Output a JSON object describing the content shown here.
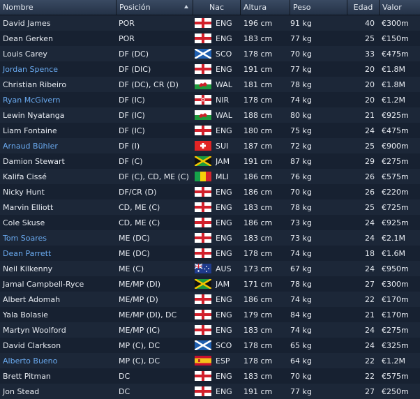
{
  "columns": {
    "name": "Nombre",
    "position": "Posición",
    "nationality": "Nac",
    "height": "Altura",
    "weight": "Peso",
    "age": "Edad",
    "value": "Valor"
  },
  "players": [
    {
      "name": "David James",
      "linked": false,
      "position": "POR",
      "flag": "eng",
      "nat": "ENG",
      "height": "196 cm",
      "weight": "91 kg",
      "age": "40",
      "value": "€300m"
    },
    {
      "name": "Dean Gerken",
      "linked": false,
      "position": "POR",
      "flag": "eng",
      "nat": "ENG",
      "height": "183 cm",
      "weight": "77 kg",
      "age": "25",
      "value": "€150m"
    },
    {
      "name": "Louis Carey",
      "linked": false,
      "position": "DF (DC)",
      "flag": "sco",
      "nat": "SCO",
      "height": "178 cm",
      "weight": "70 kg",
      "age": "33",
      "value": "€475m"
    },
    {
      "name": "Jordan Spence",
      "linked": true,
      "position": "DF (DIC)",
      "flag": "eng",
      "nat": "ENG",
      "height": "191 cm",
      "weight": "77 kg",
      "age": "20",
      "value": "€1.8M"
    },
    {
      "name": "Christian Ribeiro",
      "linked": false,
      "position": "DF (DC), CR (D)",
      "flag": "wal",
      "nat": "WAL",
      "height": "181 cm",
      "weight": "78 kg",
      "age": "20",
      "value": "€1.8M"
    },
    {
      "name": "Ryan McGivern",
      "linked": true,
      "position": "DF (IC)",
      "flag": "nir",
      "nat": "NIR",
      "height": "178 cm",
      "weight": "74 kg",
      "age": "20",
      "value": "€1.2M"
    },
    {
      "name": "Lewin Nyatanga",
      "linked": false,
      "position": "DF (IC)",
      "flag": "wal",
      "nat": "WAL",
      "height": "188 cm",
      "weight": "80 kg",
      "age": "21",
      "value": "€925m"
    },
    {
      "name": "Liam Fontaine",
      "linked": false,
      "position": "DF (IC)",
      "flag": "eng",
      "nat": "ENG",
      "height": "180 cm",
      "weight": "75 kg",
      "age": "24",
      "value": "€475m"
    },
    {
      "name": "Arnaud Bühler",
      "linked": true,
      "position": "DF (I)",
      "flag": "sui",
      "nat": "SUI",
      "height": "187 cm",
      "weight": "72 kg",
      "age": "25",
      "value": "€900m"
    },
    {
      "name": "Damion Stewart",
      "linked": false,
      "position": "DF (C)",
      "flag": "jam",
      "nat": "JAM",
      "height": "191 cm",
      "weight": "87 kg",
      "age": "29",
      "value": "€275m"
    },
    {
      "name": "Kalifa Cissé",
      "linked": false,
      "position": "DF (C), CD, ME (C)",
      "flag": "mli",
      "nat": "MLI",
      "height": "186 cm",
      "weight": "76 kg",
      "age": "26",
      "value": "€575m"
    },
    {
      "name": "Nicky Hunt",
      "linked": false,
      "position": "DF/CR (D)",
      "flag": "eng",
      "nat": "ENG",
      "height": "186 cm",
      "weight": "70 kg",
      "age": "26",
      "value": "€220m"
    },
    {
      "name": "Marvin Elliott",
      "linked": false,
      "position": "CD, ME (C)",
      "flag": "eng",
      "nat": "ENG",
      "height": "183 cm",
      "weight": "78 kg",
      "age": "25",
      "value": "€725m"
    },
    {
      "name": "Cole Skuse",
      "linked": false,
      "position": "CD, ME (C)",
      "flag": "eng",
      "nat": "ENG",
      "height": "186 cm",
      "weight": "73 kg",
      "age": "24",
      "value": "€925m"
    },
    {
      "name": "Tom Soares",
      "linked": true,
      "position": "ME (DC)",
      "flag": "eng",
      "nat": "ENG",
      "height": "183 cm",
      "weight": "73 kg",
      "age": "24",
      "value": "€2.1M"
    },
    {
      "name": "Dean Parrett",
      "linked": true,
      "position": "ME (DC)",
      "flag": "eng",
      "nat": "ENG",
      "height": "178 cm",
      "weight": "74 kg",
      "age": "18",
      "value": "€1.6M"
    },
    {
      "name": "Neil Kilkenny",
      "linked": false,
      "position": "ME (C)",
      "flag": "aus",
      "nat": "AUS",
      "height": "173 cm",
      "weight": "67 kg",
      "age": "24",
      "value": "€950m"
    },
    {
      "name": "Jamal Campbell-Ryce",
      "linked": false,
      "position": "ME/MP (DI)",
      "flag": "jam",
      "nat": "JAM",
      "height": "171 cm",
      "weight": "78 kg",
      "age": "27",
      "value": "€300m"
    },
    {
      "name": "Albert Adomah",
      "linked": false,
      "position": "ME/MP (D)",
      "flag": "eng",
      "nat": "ENG",
      "height": "186 cm",
      "weight": "74 kg",
      "age": "22",
      "value": "€170m"
    },
    {
      "name": "Yala Bolasie",
      "linked": false,
      "position": "ME/MP (DI), DC",
      "flag": "eng",
      "nat": "ENG",
      "height": "179 cm",
      "weight": "84 kg",
      "age": "21",
      "value": "€170m"
    },
    {
      "name": "Martyn Woolford",
      "linked": false,
      "position": "ME/MP (IC)",
      "flag": "eng",
      "nat": "ENG",
      "height": "183 cm",
      "weight": "74 kg",
      "age": "24",
      "value": "€275m"
    },
    {
      "name": "David Clarkson",
      "linked": false,
      "position": "MP (C), DC",
      "flag": "sco",
      "nat": "SCO",
      "height": "178 cm",
      "weight": "65 kg",
      "age": "24",
      "value": "€325m"
    },
    {
      "name": "Alberto Bueno",
      "linked": true,
      "position": "MP (C), DC",
      "flag": "esp",
      "nat": "ESP",
      "height": "178 cm",
      "weight": "64 kg",
      "age": "22",
      "value": "€1.2M"
    },
    {
      "name": "Brett Pitman",
      "linked": false,
      "position": "DC",
      "flag": "eng",
      "nat": "ENG",
      "height": "183 cm",
      "weight": "70 kg",
      "age": "22",
      "value": "€575m"
    },
    {
      "name": "Jon Stead",
      "linked": false,
      "position": "DC",
      "flag": "eng",
      "nat": "ENG",
      "height": "191 cm",
      "weight": "77 kg",
      "age": "27",
      "value": "€250m"
    }
  ]
}
